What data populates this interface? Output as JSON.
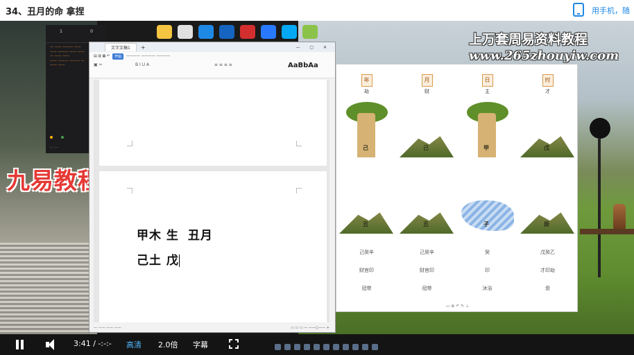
{
  "header": {
    "title": "34、丑月的命 拿捏",
    "mobile_link": "用手机，随"
  },
  "watermarks": {
    "left_red": "九易教程",
    "right_title": "上万套周易资料教程",
    "right_url": "www.265zhouyiw.com"
  },
  "side_panel": {
    "tab1_num": "1",
    "tab1_label": "",
    "tab2_num": "0",
    "tab2_label": "",
    "sub_active": "",
    "sub_other": ""
  },
  "word": {
    "tab_title": "文字文稿1",
    "line1": "甲木  生",
    "line1_suffix": "丑月",
    "line2": "己土  戊",
    "menu_active": "开始",
    "style_sample": "AaBbAa"
  },
  "chart": {
    "pillars": [
      "年",
      "月",
      "日",
      "时"
    ],
    "gods_top": [
      "劫",
      "财",
      "主",
      "才"
    ],
    "gods_bottom": [
      "己癸辛",
      "己癸辛",
      "癸",
      "戊癸乙"
    ],
    "row_a": [
      "财官印",
      "财官印",
      "印",
      "才印劫"
    ],
    "row_b": [
      "冠带",
      "冠带",
      "沐浴",
      "衰"
    ]
  },
  "controls": {
    "time": "3:41 / -:-:-",
    "quality": "高清",
    "speed": "2.0倍",
    "subtitle": "字幕"
  },
  "colors": {
    "accent_blue": "#1e88e5",
    "watermark_red": "#e53935",
    "quality_blue": "#4fb8ff"
  }
}
